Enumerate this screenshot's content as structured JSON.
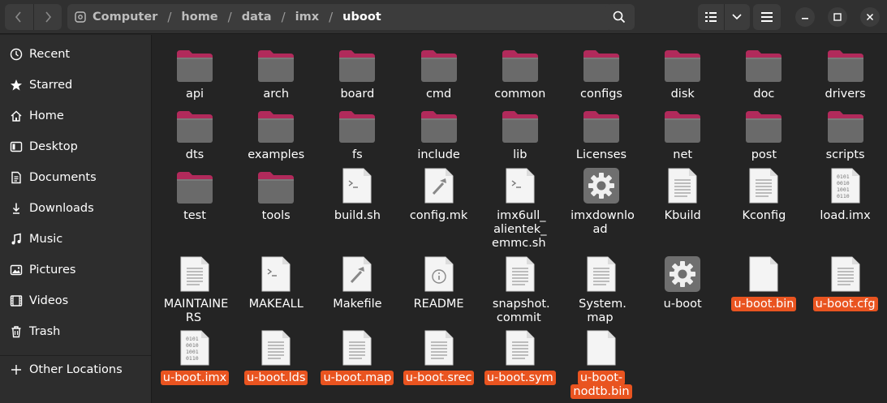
{
  "header": {
    "breadcrumb": [
      "Computer",
      "home",
      "data",
      "imx",
      "uboot"
    ]
  },
  "sidebar": {
    "items": [
      {
        "label": "Recent",
        "icon": "clock-icon"
      },
      {
        "label": "Starred",
        "icon": "star-icon"
      },
      {
        "label": "Home",
        "icon": "home-icon"
      },
      {
        "label": "Desktop",
        "icon": "desktop-icon"
      },
      {
        "label": "Documents",
        "icon": "document-icon"
      },
      {
        "label": "Downloads",
        "icon": "download-icon"
      },
      {
        "label": "Music",
        "icon": "music-icon"
      },
      {
        "label": "Pictures",
        "icon": "picture-icon"
      },
      {
        "label": "Videos",
        "icon": "video-icon"
      },
      {
        "label": "Trash",
        "icon": "trash-icon"
      }
    ],
    "other_locations": {
      "label": "Other Locations",
      "icon": "plus-icon"
    }
  },
  "files": [
    {
      "name": "api",
      "type": "folder"
    },
    {
      "name": "arch",
      "type": "folder"
    },
    {
      "name": "board",
      "type": "folder"
    },
    {
      "name": "cmd",
      "type": "folder"
    },
    {
      "name": "common",
      "type": "folder"
    },
    {
      "name": "configs",
      "type": "folder"
    },
    {
      "name": "disk",
      "type": "folder"
    },
    {
      "name": "doc",
      "type": "folder"
    },
    {
      "name": "drivers",
      "type": "folder"
    },
    {
      "name": "dts",
      "type": "folder"
    },
    {
      "name": "examples",
      "type": "folder"
    },
    {
      "name": "fs",
      "type": "folder"
    },
    {
      "name": "include",
      "type": "folder"
    },
    {
      "name": "lib",
      "type": "folder"
    },
    {
      "name": "Licenses",
      "type": "folder"
    },
    {
      "name": "net",
      "type": "folder"
    },
    {
      "name": "post",
      "type": "folder"
    },
    {
      "name": "scripts",
      "type": "folder"
    },
    {
      "name": "test",
      "type": "folder"
    },
    {
      "name": "tools",
      "type": "folder"
    },
    {
      "name": "build.sh",
      "type": "script"
    },
    {
      "name": "config.mk",
      "type": "make"
    },
    {
      "name": "imx6ull_\nalientek_\nemmc.sh",
      "type": "script"
    },
    {
      "name": "imxdownlo\nad",
      "type": "executable"
    },
    {
      "name": "Kbuild",
      "type": "text"
    },
    {
      "name": "Kconfig",
      "type": "text"
    },
    {
      "name": "load.imx",
      "type": "binary"
    },
    {
      "name": "MAINTAINE\nRS",
      "type": "text"
    },
    {
      "name": "MAKEALL",
      "type": "script"
    },
    {
      "name": "Makefile",
      "type": "make"
    },
    {
      "name": "README",
      "type": "readme"
    },
    {
      "name": "snapshot.\ncommit",
      "type": "text"
    },
    {
      "name": "System.\nmap",
      "type": "text"
    },
    {
      "name": "u-boot",
      "type": "executable"
    },
    {
      "name": "u-boot.bin",
      "type": "blank",
      "selected": true
    },
    {
      "name": "u-boot.cfg",
      "type": "text",
      "selected": true
    },
    {
      "name": "u-boot.imx",
      "type": "binary",
      "selected": true
    },
    {
      "name": "u-boot.lds",
      "type": "text",
      "selected": true
    },
    {
      "name": "u-boot.map",
      "type": "text",
      "selected": true
    },
    {
      "name": "u-boot.srec",
      "type": "text",
      "selected": true
    },
    {
      "name": "u-boot.sym",
      "type": "text",
      "selected": true
    },
    {
      "name": "u-boot-\nnodtb.bin",
      "type": "blank",
      "selected": true
    }
  ],
  "colors": {
    "accent": "#e95420",
    "folder_tab": "#b12a5b",
    "folder_body": "#6a6a6a"
  }
}
